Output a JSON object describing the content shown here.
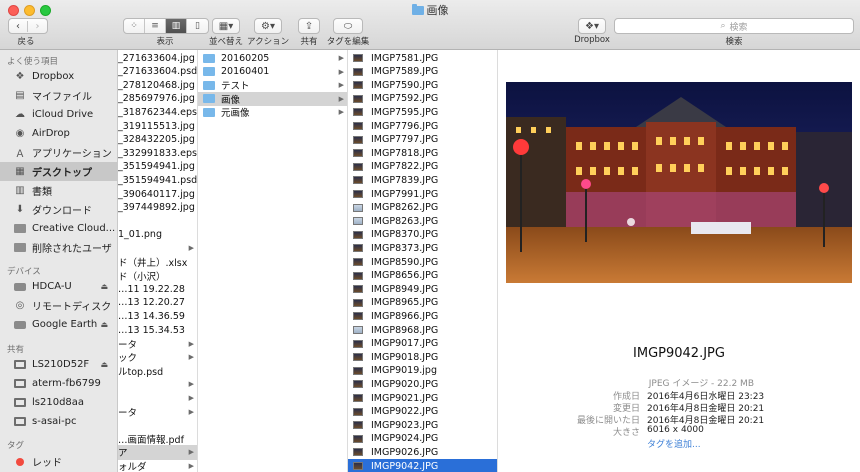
{
  "window": {
    "title": "画像"
  },
  "toolbar": {
    "back_label": "戻る",
    "view_label": "表示",
    "sort_label": "並べ替え",
    "action_label": "アクション",
    "share_label": "共有",
    "tag_label": "タグを編集",
    "dropbox_label": "Dropbox",
    "search_label": "検索",
    "search_placeholder": "検索"
  },
  "sidebar": {
    "favorites_heading": "よく使う項目",
    "favorites": [
      {
        "label": "Dropbox",
        "icon": "dropbox-icon"
      },
      {
        "label": "マイファイル",
        "icon": "my-files-icon"
      },
      {
        "label": "iCloud Drive",
        "icon": "cloud-icon"
      },
      {
        "label": "AirDrop",
        "icon": "airdrop-icon"
      },
      {
        "label": "アプリケーション",
        "icon": "applications-icon"
      },
      {
        "label": "デスクトップ",
        "icon": "desktop-icon",
        "selected": true
      },
      {
        "label": "書類",
        "icon": "documents-icon"
      },
      {
        "label": "ダウンロード",
        "icon": "downloads-icon"
      },
      {
        "label": "Creative Cloud...",
        "icon": "folder-icon"
      },
      {
        "label": "削除されたユーザ",
        "icon": "folder-icon"
      }
    ],
    "devices_heading": "デバイス",
    "devices": [
      {
        "label": "HDCA-U",
        "icon": "drive-icon",
        "eject": true
      },
      {
        "label": "リモートディスク",
        "icon": "remote-disc-icon"
      },
      {
        "label": "Google Earth",
        "icon": "drive-icon",
        "eject": true
      }
    ],
    "shared_heading": "共有",
    "shared": [
      {
        "label": "LS210D52F",
        "icon": "monitor-icon",
        "eject": true
      },
      {
        "label": "aterm-fb6799",
        "icon": "monitor-icon"
      },
      {
        "label": "ls210d8aa",
        "icon": "monitor-icon"
      },
      {
        "label": "s-asai-pc",
        "icon": "monitor-icon"
      }
    ],
    "tags_heading": "タグ",
    "tags": [
      {
        "label": "レッド",
        "color": "#f24a3e"
      }
    ]
  },
  "column1": [
    {
      "label": "_271633604.jpg"
    },
    {
      "label": "_271633604.psd"
    },
    {
      "label": "_278120468.jpg"
    },
    {
      "label": "_285697976.jpg"
    },
    {
      "label": "_318762344.eps"
    },
    {
      "label": "_319115513.jpg"
    },
    {
      "label": "_328432205.jpg"
    },
    {
      "label": "_332991833.eps"
    },
    {
      "label": "_351594941.jpg"
    },
    {
      "label": "_351594941.psd"
    },
    {
      "label": "_390640117.jpg"
    },
    {
      "label": "_397449892.jpg"
    },
    {
      "label": ""
    },
    {
      "label": "1_01.png"
    },
    {
      "label": "",
      "arrow": true
    },
    {
      "label": "ド（井上）.xlsx"
    },
    {
      "label": "ド（小沢）"
    },
    {
      "label": "…11 19.22.28"
    },
    {
      "label": "…13 12.20.27"
    },
    {
      "label": "…13 14.36.59"
    },
    {
      "label": "…13 15.34.53"
    },
    {
      "label": "ータ",
      "arrow": true
    },
    {
      "label": "ック",
      "arrow": true
    },
    {
      "label": "ルtop.psd"
    },
    {
      "label": "",
      "arrow": true
    },
    {
      "label": "",
      "arrow": true
    },
    {
      "label": "ータ",
      "arrow": true
    },
    {
      "label": ""
    },
    {
      "label": "…画面情報.pdf"
    },
    {
      "label": "ア",
      "arrow": true,
      "highlight": true
    },
    {
      "label": "ォルダ",
      "arrow": true
    },
    {
      "label": "ォルダ 2",
      "arrow": true
    }
  ],
  "column2": [
    {
      "label": "20160205",
      "arrow": true
    },
    {
      "label": "20160401",
      "arrow": true
    },
    {
      "label": "テスト",
      "arrow": true
    },
    {
      "label": "画像",
      "arrow": true,
      "highlight": true
    },
    {
      "label": "元画像",
      "arrow": true
    }
  ],
  "column3": [
    {
      "label": "IMGP7581.JPG"
    },
    {
      "label": "IMGP7589.JPG"
    },
    {
      "label": "IMGP7590.JPG"
    },
    {
      "label": "IMGP7592.JPG"
    },
    {
      "label": "IMGP7595.JPG"
    },
    {
      "label": "IMGP7796.JPG"
    },
    {
      "label": "IMGP7797.JPG"
    },
    {
      "label": "IMGP7818.JPG"
    },
    {
      "label": "IMGP7822.JPG"
    },
    {
      "label": "IMGP7839.JPG"
    },
    {
      "label": "IMGP7991.JPG"
    },
    {
      "label": "IMGP8262.JPG"
    },
    {
      "label": "IMGP8263.JPG"
    },
    {
      "label": "IMGP8370.JPG"
    },
    {
      "label": "IMGP8373.JPG"
    },
    {
      "label": "IMGP8590.JPG"
    },
    {
      "label": "IMGP8656.JPG"
    },
    {
      "label": "IMGP8949.JPG"
    },
    {
      "label": "IMGP8965.JPG"
    },
    {
      "label": "IMGP8966.JPG"
    },
    {
      "label": "IMGP8968.JPG"
    },
    {
      "label": "IMGP9017.JPG"
    },
    {
      "label": "IMGP9018.JPG"
    },
    {
      "label": "IMGP9019.jpg"
    },
    {
      "label": "IMGP9020.JPG"
    },
    {
      "label": "IMGP9021.JPG"
    },
    {
      "label": "IMGP9022.JPG"
    },
    {
      "label": "IMGP9023.JPG"
    },
    {
      "label": "IMGP9024.JPG"
    },
    {
      "label": "IMGP9026.JPG"
    },
    {
      "label": "IMGP9042.JPG",
      "selected": true
    },
    {
      "label": "IMGP9044.JPG"
    }
  ],
  "preview": {
    "filename": "IMGP9042.JPG",
    "kind": "JPEG イメージ - 22.2 MB",
    "meta": [
      {
        "key": "作成日",
        "value": "2016年4月6日水曜日 23:23"
      },
      {
        "key": "変更日",
        "value": "2016年4月8日金曜日 20:21"
      },
      {
        "key": "最後に開いた日",
        "value": "2016年4月8日金曜日 20:21"
      },
      {
        "key": "大きさ",
        "value": "6016 x 4000"
      }
    ],
    "add_tags": "タグを追加..."
  }
}
